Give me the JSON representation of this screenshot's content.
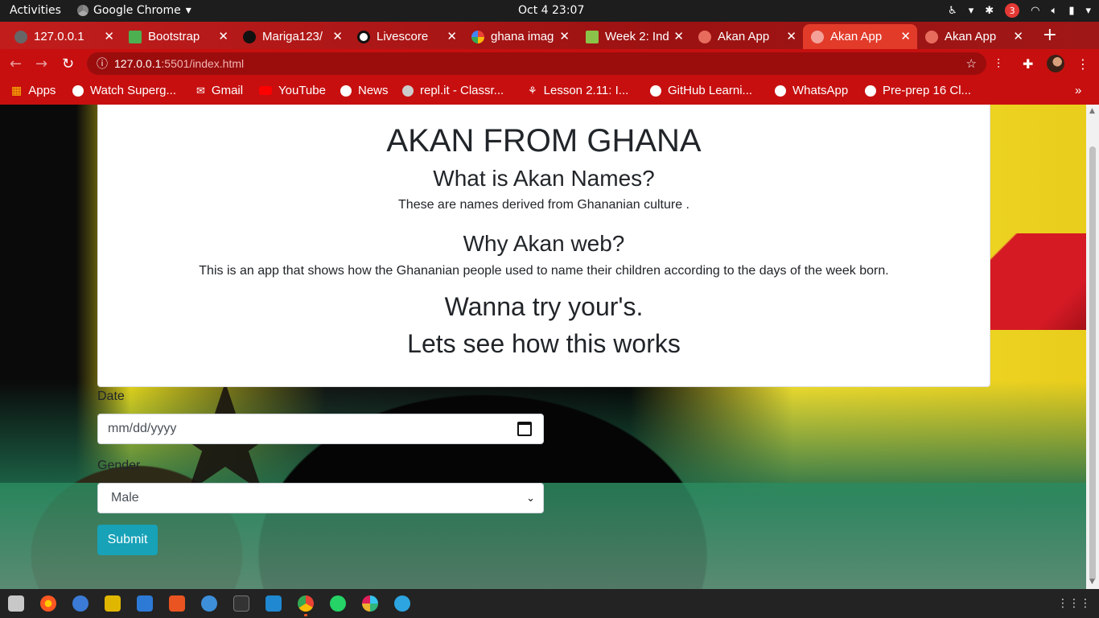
{
  "topbar": {
    "activities": "Activities",
    "app_name": "Google Chrome",
    "clock": "Oct 4  23:07",
    "notification_count": "3"
  },
  "tabs": [
    {
      "title": "127.0.0.1"
    },
    {
      "title": "Bootstrap"
    },
    {
      "title": "Mariga123/"
    },
    {
      "title": "Livescore"
    },
    {
      "title": "ghana imag"
    },
    {
      "title": "Week 2: Ind"
    },
    {
      "title": "Akan App"
    },
    {
      "title": "Akan App",
      "active": true
    },
    {
      "title": "Akan App"
    }
  ],
  "toolbar": {
    "url_host": "127.0.0.1",
    "url_path": ":5501/index.html"
  },
  "bookmarks": [
    {
      "label": "Apps"
    },
    {
      "label": "Watch Superg..."
    },
    {
      "label": "Gmail"
    },
    {
      "label": "YouTube"
    },
    {
      "label": "News"
    },
    {
      "label": "repl.it - Classr..."
    },
    {
      "label": "Lesson 2.11: I..."
    },
    {
      "label": "GitHub Learni..."
    },
    {
      "label": "WhatsApp"
    },
    {
      "label": "Pre-prep 16 Cl..."
    }
  ],
  "page": {
    "title": "AKAN FROM GHANA",
    "q1": "What is Akan Names?",
    "a1": "These are names derived from Ghananian culture .",
    "q2": "Why Akan web?",
    "a2": "This is an app that shows how the Ghananian people used to name their children according to the days of the week born.",
    "cta1": "Wanna try your's.",
    "cta2": "Lets see how this works",
    "date_label": "Date",
    "date_placeholder": "mm/dd/yyyy",
    "gender_label": "Gender",
    "gender_value": "Male",
    "submit_label": "Submit"
  },
  "colors": {
    "chrome_theme": "#c70f0f",
    "submit_button": "#17a2b8"
  }
}
